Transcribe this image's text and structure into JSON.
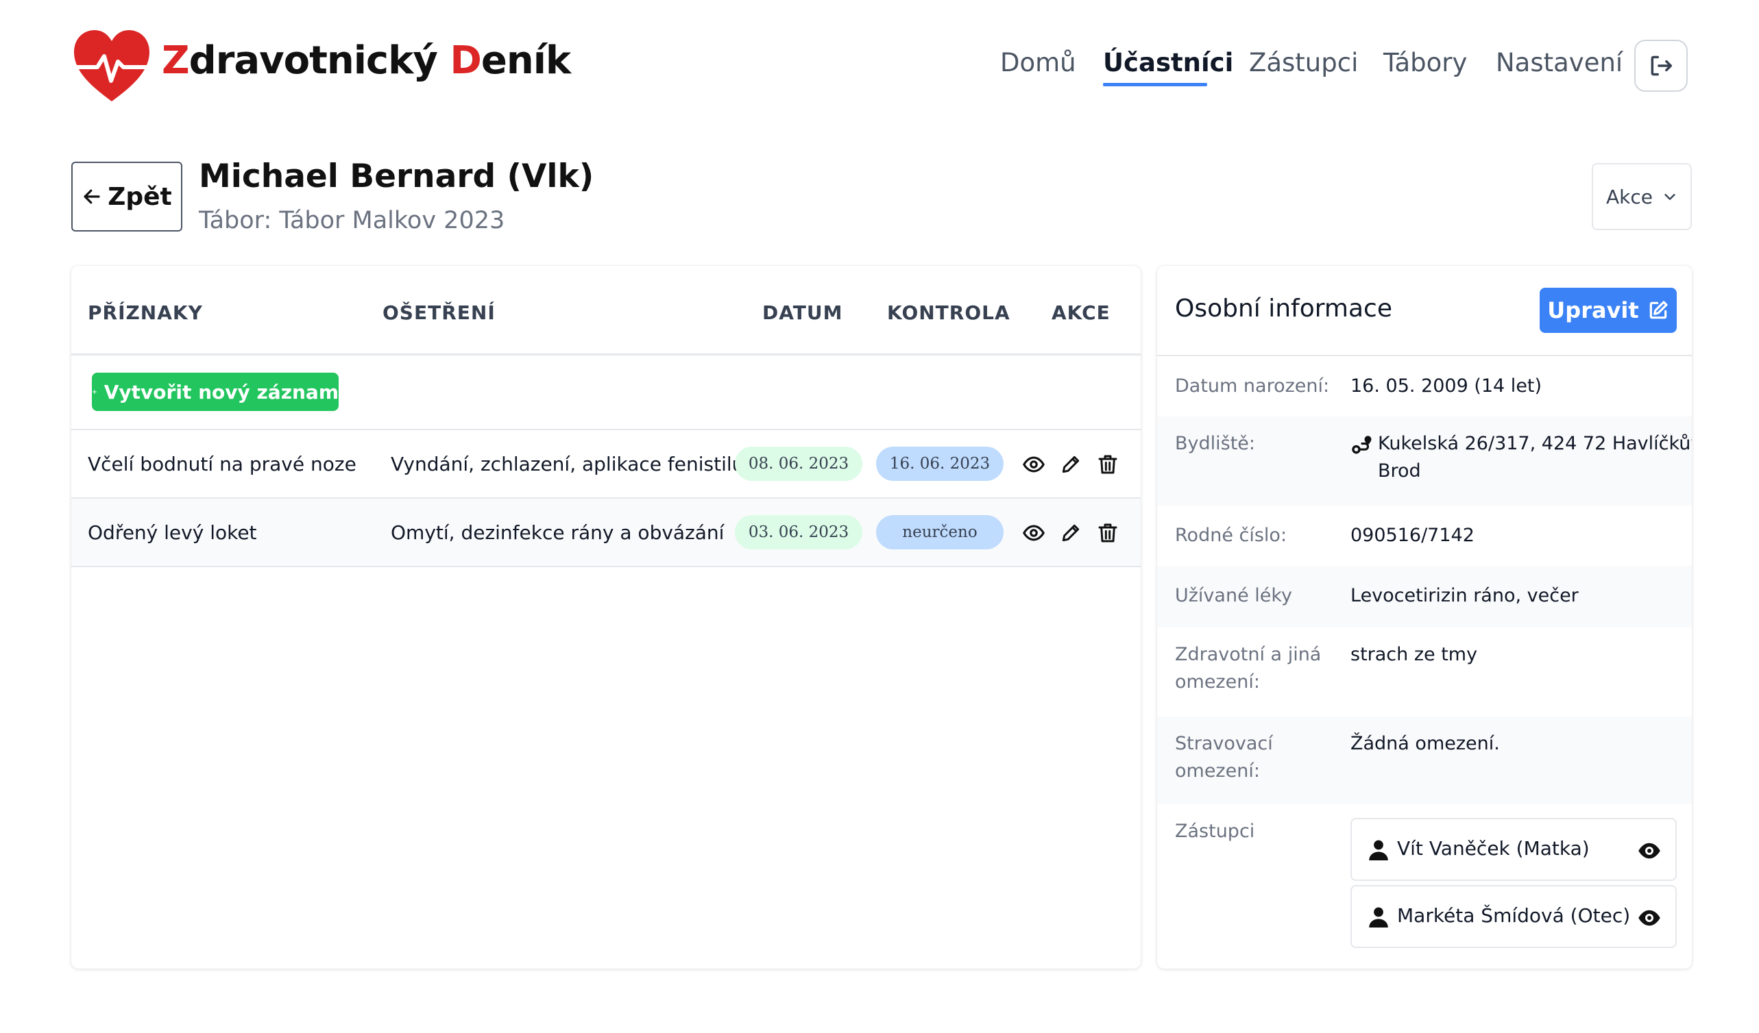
{
  "brand": {
    "part1_initial": "Z",
    "part1_rest": "dravotnický ",
    "part2_initial": "D",
    "part2_rest": "eník"
  },
  "nav": {
    "items": [
      "Domů",
      "Účastníci",
      "Zástupci",
      "Tábory",
      "Nastavení"
    ],
    "active": "Účastníci"
  },
  "header": {
    "logout_icon": "logout-icon"
  },
  "page": {
    "back_label": "Zpět",
    "name": "Michael Bernard (Vlk)",
    "camp": "Tábor: Tábor Malkov 2023",
    "actions_label": "Akce"
  },
  "records": {
    "columns": {
      "symptoms": "PŘÍZNAKY",
      "treatment": "OŠETŘENÍ",
      "date": "DATUM",
      "check": "KONTROLA",
      "actions": "AKCE"
    },
    "new_label": "Vytvořit nový záznam",
    "rows": [
      {
        "symptom": "Včelí bodnutí na pravé noze",
        "treatment": "Vyndání, zchlazení, aplikace fenistilu",
        "date": "08. 06. 2023",
        "check": "16. 06. 2023"
      },
      {
        "symptom": "Odřený levý loket",
        "treatment": "Omytí, dezinfekce rány a obvázání",
        "date": "03. 06. 2023",
        "check": "neurčeno"
      }
    ]
  },
  "personal": {
    "title": "Osobní informace",
    "edit_label": "Upravit",
    "birth_label": "Datum narození:",
    "birth_value": "16. 05. 2009 (14 let)",
    "address_label": "Bydliště:",
    "address_line1": "Kukelská 26/317, 424 72 Havlíčkův",
    "address_line2": "Brod",
    "id_label": "Rodné číslo:",
    "id_value": "090516/7142",
    "meds_label": "Užívané léky",
    "meds_value": "Levocetirizin ráno, večer",
    "health_label_1": "Zdravotní a jiná",
    "health_label_2": "omezení:",
    "health_value": "strach ze tmy",
    "diet_label_1": "Stravovací",
    "diet_label_2": "omezení:",
    "diet_value": "Žádná omezení.",
    "reps_label": "Zástupci",
    "reps": [
      "Vít Vaněček (Matka)",
      "Markéta Šmídová (Otec)"
    ]
  },
  "colors": {
    "primary": "#3b82f6",
    "success": "#22c55e",
    "brand_red": "#dc2626",
    "date_pill": "#dcfce7",
    "check_pill": "#bfdbfe"
  }
}
